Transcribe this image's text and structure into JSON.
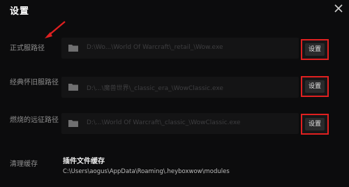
{
  "dialog": {
    "title": "设置",
    "close_icon": "close-icon"
  },
  "rows": [
    {
      "label": "正式服路径",
      "path": "D:\\Wo...\\World Of Warcraft\\_retail_\\Wow.exe",
      "button": "设置"
    },
    {
      "label": "经典怀旧服路径",
      "path": "D:\\...\\魔兽世界\\_classic_era_\\WowClassic.exe",
      "button": "设置"
    },
    {
      "label": "燃烧的远征路径",
      "path": "D:\\...\\World Of Warcraft\\_classic_\\WowClassic.exe",
      "button": "设置"
    }
  ],
  "cache": {
    "label": "清理缓存",
    "title": "插件文件缓存",
    "path": "C:\\Users\\aogus\\AppData\\Roaming\\.heyboxwow\\modules"
  },
  "colors": {
    "highlight": "#e02020",
    "background": "#0c0c0d"
  }
}
